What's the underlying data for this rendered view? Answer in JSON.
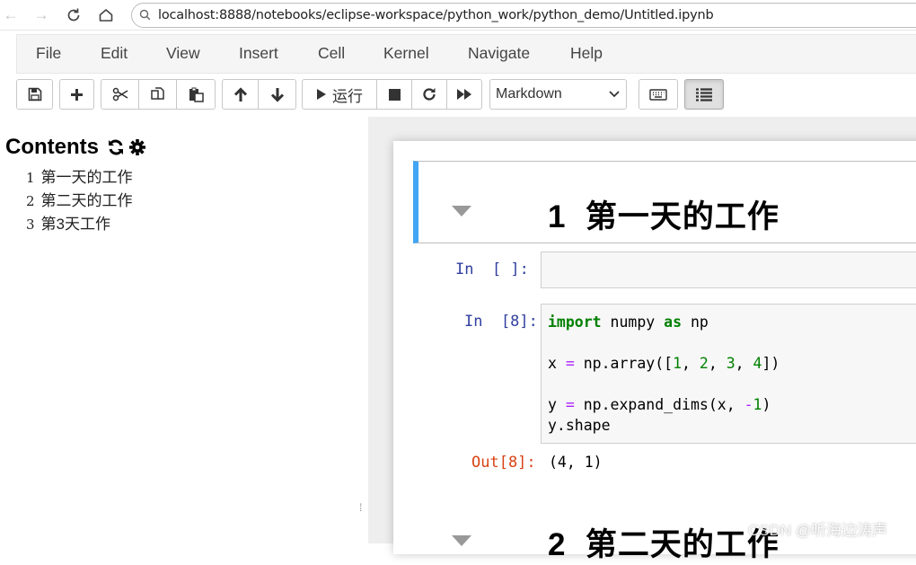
{
  "browser": {
    "url": "localhost:8888/notebooks/eclipse-workspace/python_work/python_demo/Untitled.ipynb"
  },
  "menu": {
    "items": [
      "File",
      "Edit",
      "View",
      "Insert",
      "Cell",
      "Kernel",
      "Navigate",
      "Help"
    ]
  },
  "toolbar": {
    "run_label": "运行",
    "cell_type": "Markdown",
    "icons": [
      "save-icon",
      "plus-icon",
      "scissors-icon",
      "copy-icon",
      "paste-icon",
      "arrow-up-icon",
      "arrow-down-icon",
      "play-icon",
      "stop-icon",
      "restart-icon",
      "fast-forward-icon",
      "keyboard-icon",
      "list-icon"
    ]
  },
  "toc": {
    "title": "Contents",
    "items": [
      {
        "num": "1",
        "label": "第一天的工作"
      },
      {
        "num": "2",
        "label": "第二天的工作"
      },
      {
        "num": "3",
        "label": "第3天工作"
      }
    ]
  },
  "notebook": {
    "heading1": {
      "num": "1",
      "text": "第一天的工作"
    },
    "empty_cell_prompt": "In  [ ]:",
    "code_cell_prompt": "In  [8]:",
    "output_prompt": "Out[8]:",
    "output_value": "(4, 1)",
    "heading2": {
      "num": "2",
      "text": "第二天的工作"
    }
  },
  "watermark": "CSDN @听海边涛声",
  "colors": {
    "selected_cell": "#42a5f5",
    "in_prompt": "#303f9f",
    "out_prompt": "#d84315",
    "keyword": "#008000",
    "operator": "#aa22ff"
  }
}
